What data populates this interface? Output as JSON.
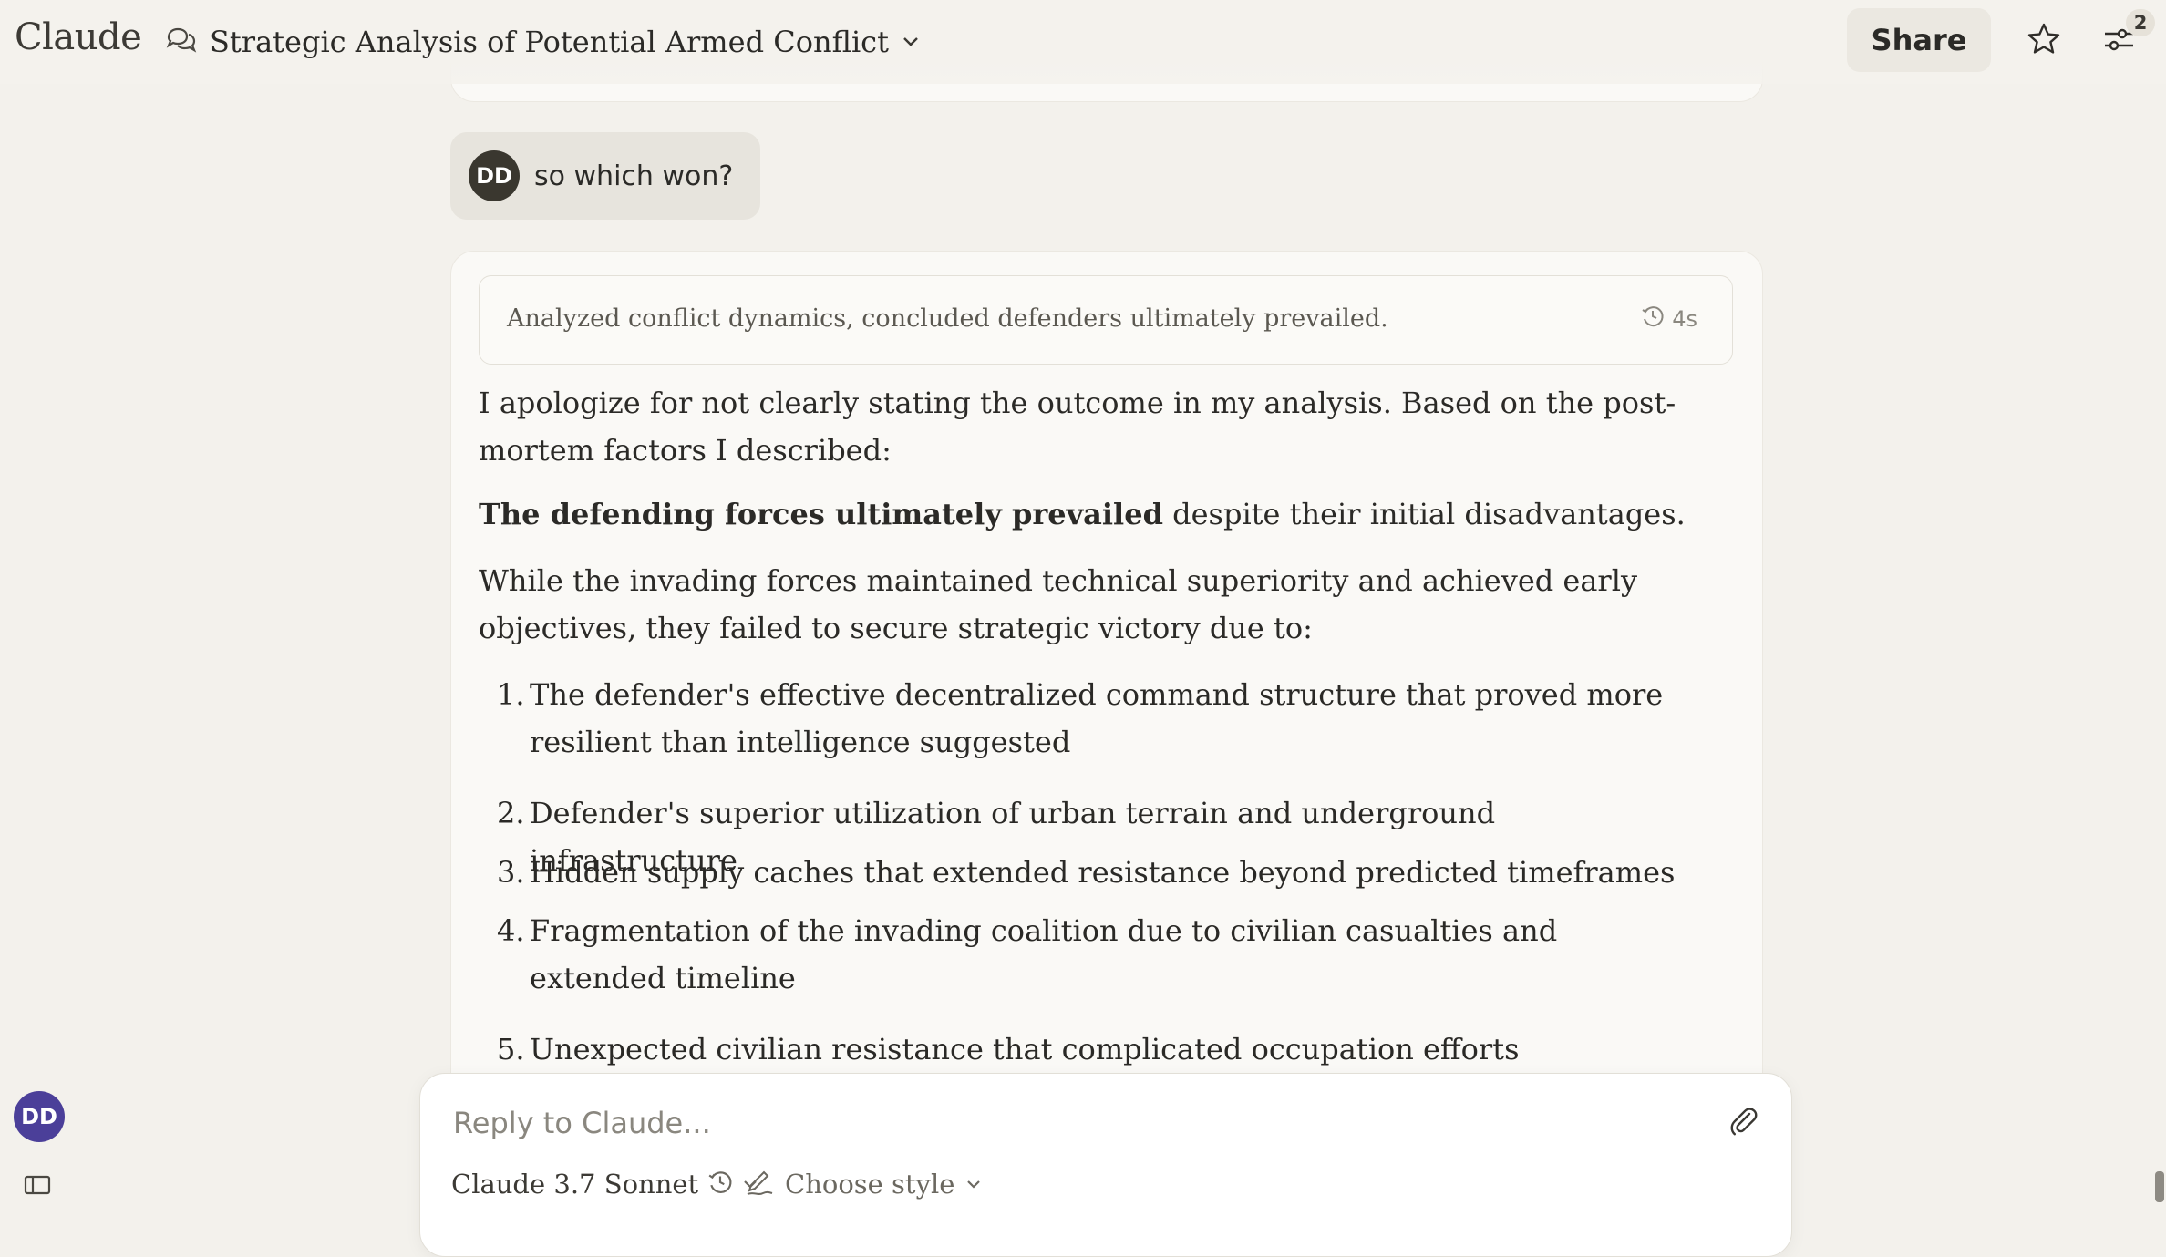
{
  "app": {
    "name": "Claude"
  },
  "header": {
    "title": "Strategic Analysis of Potential Armed Conflict",
    "share_label": "Share",
    "settings_badge": "2"
  },
  "user_message": {
    "initials": "DD",
    "text": "so which won?"
  },
  "assistant": {
    "thinking_summary": "Analyzed conflict dynamics, concluded defenders ultimately prevailed.",
    "thinking_time": "4s",
    "intro": "I apologize for not clearly stating the outcome in my analysis. Based on the post-mortem factors I described:",
    "bold_lead": "The defending forces ultimately prevailed",
    "bold_rest": " despite their initial disadvantages.",
    "paragraph2": "While the invading forces maintained technical superiority and achieved early objectives, they failed to secure strategic victory due to:",
    "list": [
      {
        "num": "1.",
        "text": "The defender's effective decentralized command structure that proved more resilient than intelligence suggested"
      },
      {
        "num": "2.",
        "text": "Defender's superior utilization of urban terrain and underground infrastructure"
      },
      {
        "num": "3.",
        "text": "Hidden supply caches that extended resistance beyond predicted timeframes"
      },
      {
        "num": "4.",
        "text": "Fragmentation of the invading coalition due to civilian casualties and extended timeline"
      },
      {
        "num": "5.",
        "text": "Unexpected civilian resistance that complicated occupation efforts"
      }
    ]
  },
  "composer": {
    "placeholder": "Reply to Claude...",
    "model": "Claude 3.7 Sonnet",
    "style": "Choose style"
  },
  "sidebar": {
    "user_initials": "DD"
  },
  "colors": {
    "background": "#f3f1ec",
    "card": "#faf9f6",
    "avatar_user": "#3a372f",
    "avatar_sidebar": "#4b3f99"
  }
}
